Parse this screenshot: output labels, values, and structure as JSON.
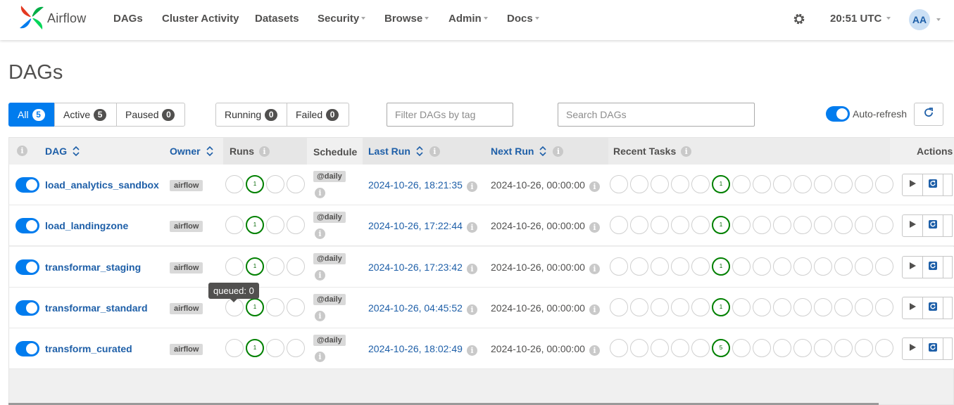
{
  "brand": {
    "name": "Airflow"
  },
  "nav": [
    {
      "label": "DAGs",
      "dropdown": false
    },
    {
      "label": "Cluster Activity",
      "dropdown": false
    },
    {
      "label": "Datasets",
      "dropdown": false
    },
    {
      "label": "Security",
      "dropdown": true
    },
    {
      "label": "Browse",
      "dropdown": true
    },
    {
      "label": "Admin",
      "dropdown": true
    },
    {
      "label": "Docs",
      "dropdown": true
    }
  ],
  "header": {
    "time": "20:51 UTC",
    "avatar_initials": "AA"
  },
  "page": {
    "title": "DAGs"
  },
  "filters": {
    "status": [
      {
        "label": "All",
        "count": "5",
        "active": true
      },
      {
        "label": "Active",
        "count": "5",
        "active": false
      },
      {
        "label": "Paused",
        "count": "0",
        "active": false
      }
    ],
    "runs": [
      {
        "label": "Running",
        "count": "0"
      },
      {
        "label": "Failed",
        "count": "0"
      }
    ],
    "tag_placeholder": "Filter DAGs by tag",
    "search_placeholder": "Search DAGs",
    "auto_refresh_label": "Auto-refresh",
    "auto_refresh_on": true
  },
  "table": {
    "columns": {
      "dag": "DAG",
      "owner": "Owner",
      "runs": "Runs",
      "schedule": "Schedule",
      "last_run": "Last Run",
      "next_run": "Next Run",
      "recent_tasks": "Recent Tasks",
      "actions": "Actions"
    },
    "rows": [
      {
        "name": "load_analytics_sandbox",
        "owner": "airflow",
        "runs": [
          "",
          "1",
          "",
          ""
        ],
        "schedule": "@daily",
        "last_run": "2024-10-26, 18:21:35",
        "next_run": "2024-10-26, 00:00:00",
        "tasks": [
          "",
          "",
          "",
          "",
          "",
          "1",
          "",
          "",
          "",
          "",
          "",
          "",
          "",
          ""
        ],
        "enabled": true
      },
      {
        "name": "load_landingzone",
        "owner": "airflow",
        "runs": [
          "",
          "1",
          "",
          ""
        ],
        "schedule": "@daily",
        "last_run": "2024-10-26, 17:22:44",
        "next_run": "2024-10-26, 00:00:00",
        "tasks": [
          "",
          "",
          "",
          "",
          "",
          "1",
          "",
          "",
          "",
          "",
          "",
          "",
          "",
          ""
        ],
        "enabled": true
      },
      {
        "name": "transformar_staging",
        "owner": "airflow",
        "runs": [
          "",
          "1",
          "",
          ""
        ],
        "schedule": "@daily",
        "last_run": "2024-10-26, 17:23:42",
        "next_run": "2024-10-26, 00:00:00",
        "tasks": [
          "",
          "",
          "",
          "",
          "",
          "1",
          "",
          "",
          "",
          "",
          "",
          "",
          "",
          ""
        ],
        "enabled": true
      },
      {
        "name": "transformar_standard",
        "owner": "airflow",
        "runs": [
          "",
          "1",
          "",
          ""
        ],
        "schedule": "@daily",
        "last_run": "2024-10-26, 04:45:52",
        "next_run": "2024-10-26, 00:00:00",
        "tasks": [
          "",
          "",
          "",
          "",
          "",
          "1",
          "",
          "",
          "",
          "",
          "",
          "",
          "",
          ""
        ],
        "enabled": true
      },
      {
        "name": "transform_curated",
        "owner": "airflow",
        "runs": [
          "",
          "1",
          "",
          ""
        ],
        "schedule": "@daily",
        "last_run": "2024-10-26, 18:02:49",
        "next_run": "2024-10-26, 00:00:00",
        "tasks": [
          "",
          "",
          "",
          "",
          "",
          "5",
          "",
          "",
          "",
          "",
          "",
          "",
          "",
          ""
        ],
        "enabled": true
      }
    ]
  },
  "tooltip": {
    "text": "queued: 0"
  },
  "colors": {
    "accent": "#017cee",
    "link": "#1e5fa8",
    "success": "#008000",
    "text": "#51504f"
  }
}
